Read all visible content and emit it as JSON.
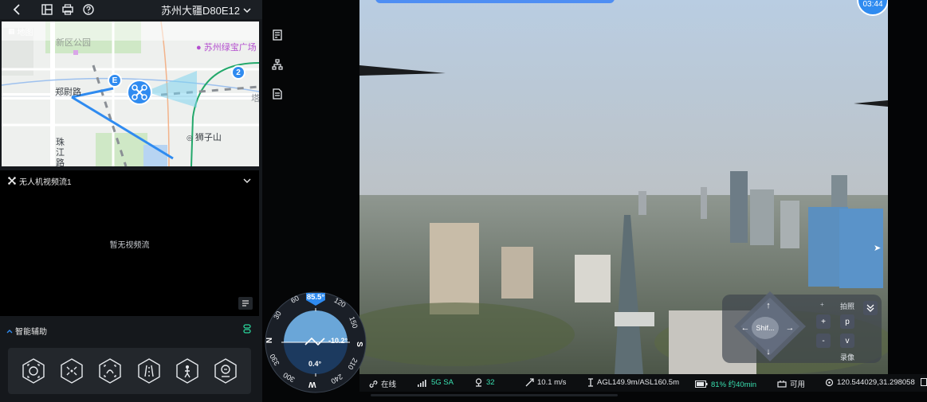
{
  "topbar": {
    "title": "苏州大疆D80E12"
  },
  "map": {
    "header": "地图",
    "labels": {
      "xinqu_park": "新区公园",
      "greenland": "苏州绿宝广场",
      "zhengyi_road": "郑尉路",
      "zhujiang_road_1": "珠",
      "zhujiang_road_2": "江",
      "zhujiang_road_3": "路",
      "shizishan": "狮子山",
      "xue": "塔"
    },
    "marker_e": "E",
    "marker_2": "2"
  },
  "video": {
    "title": "无人机视频流1",
    "empty_text": "暂无视频流"
  },
  "assist": {
    "title": "智能辅助"
  },
  "camera": {
    "timer": "03:44"
  },
  "compass": {
    "heading": "85.5°",
    "pitch": "-10.2°",
    "speed": "0.4°",
    "marks": [
      "60",
      "120",
      "30",
      "150",
      "N",
      "S",
      "330",
      "210",
      "300",
      "240",
      "W"
    ]
  },
  "dpad": {
    "center": "Shif...",
    "photo": "拍照",
    "record": "录像",
    "p": "p",
    "v": "v",
    "plus": "+",
    "minus": "-"
  },
  "status": {
    "online": "在线",
    "network": "5G SA",
    "satellites": "32",
    "speed": "10.1 m/s",
    "altitude": "AGL149.9m/ASL160.5m",
    "battery": "81% 约40min",
    "available": "可用",
    "coords": "120.544029,31.298058"
  },
  "colors": {
    "accent": "#2f8bf0",
    "green": "#2ad39a",
    "battery": "#39e0b0"
  }
}
